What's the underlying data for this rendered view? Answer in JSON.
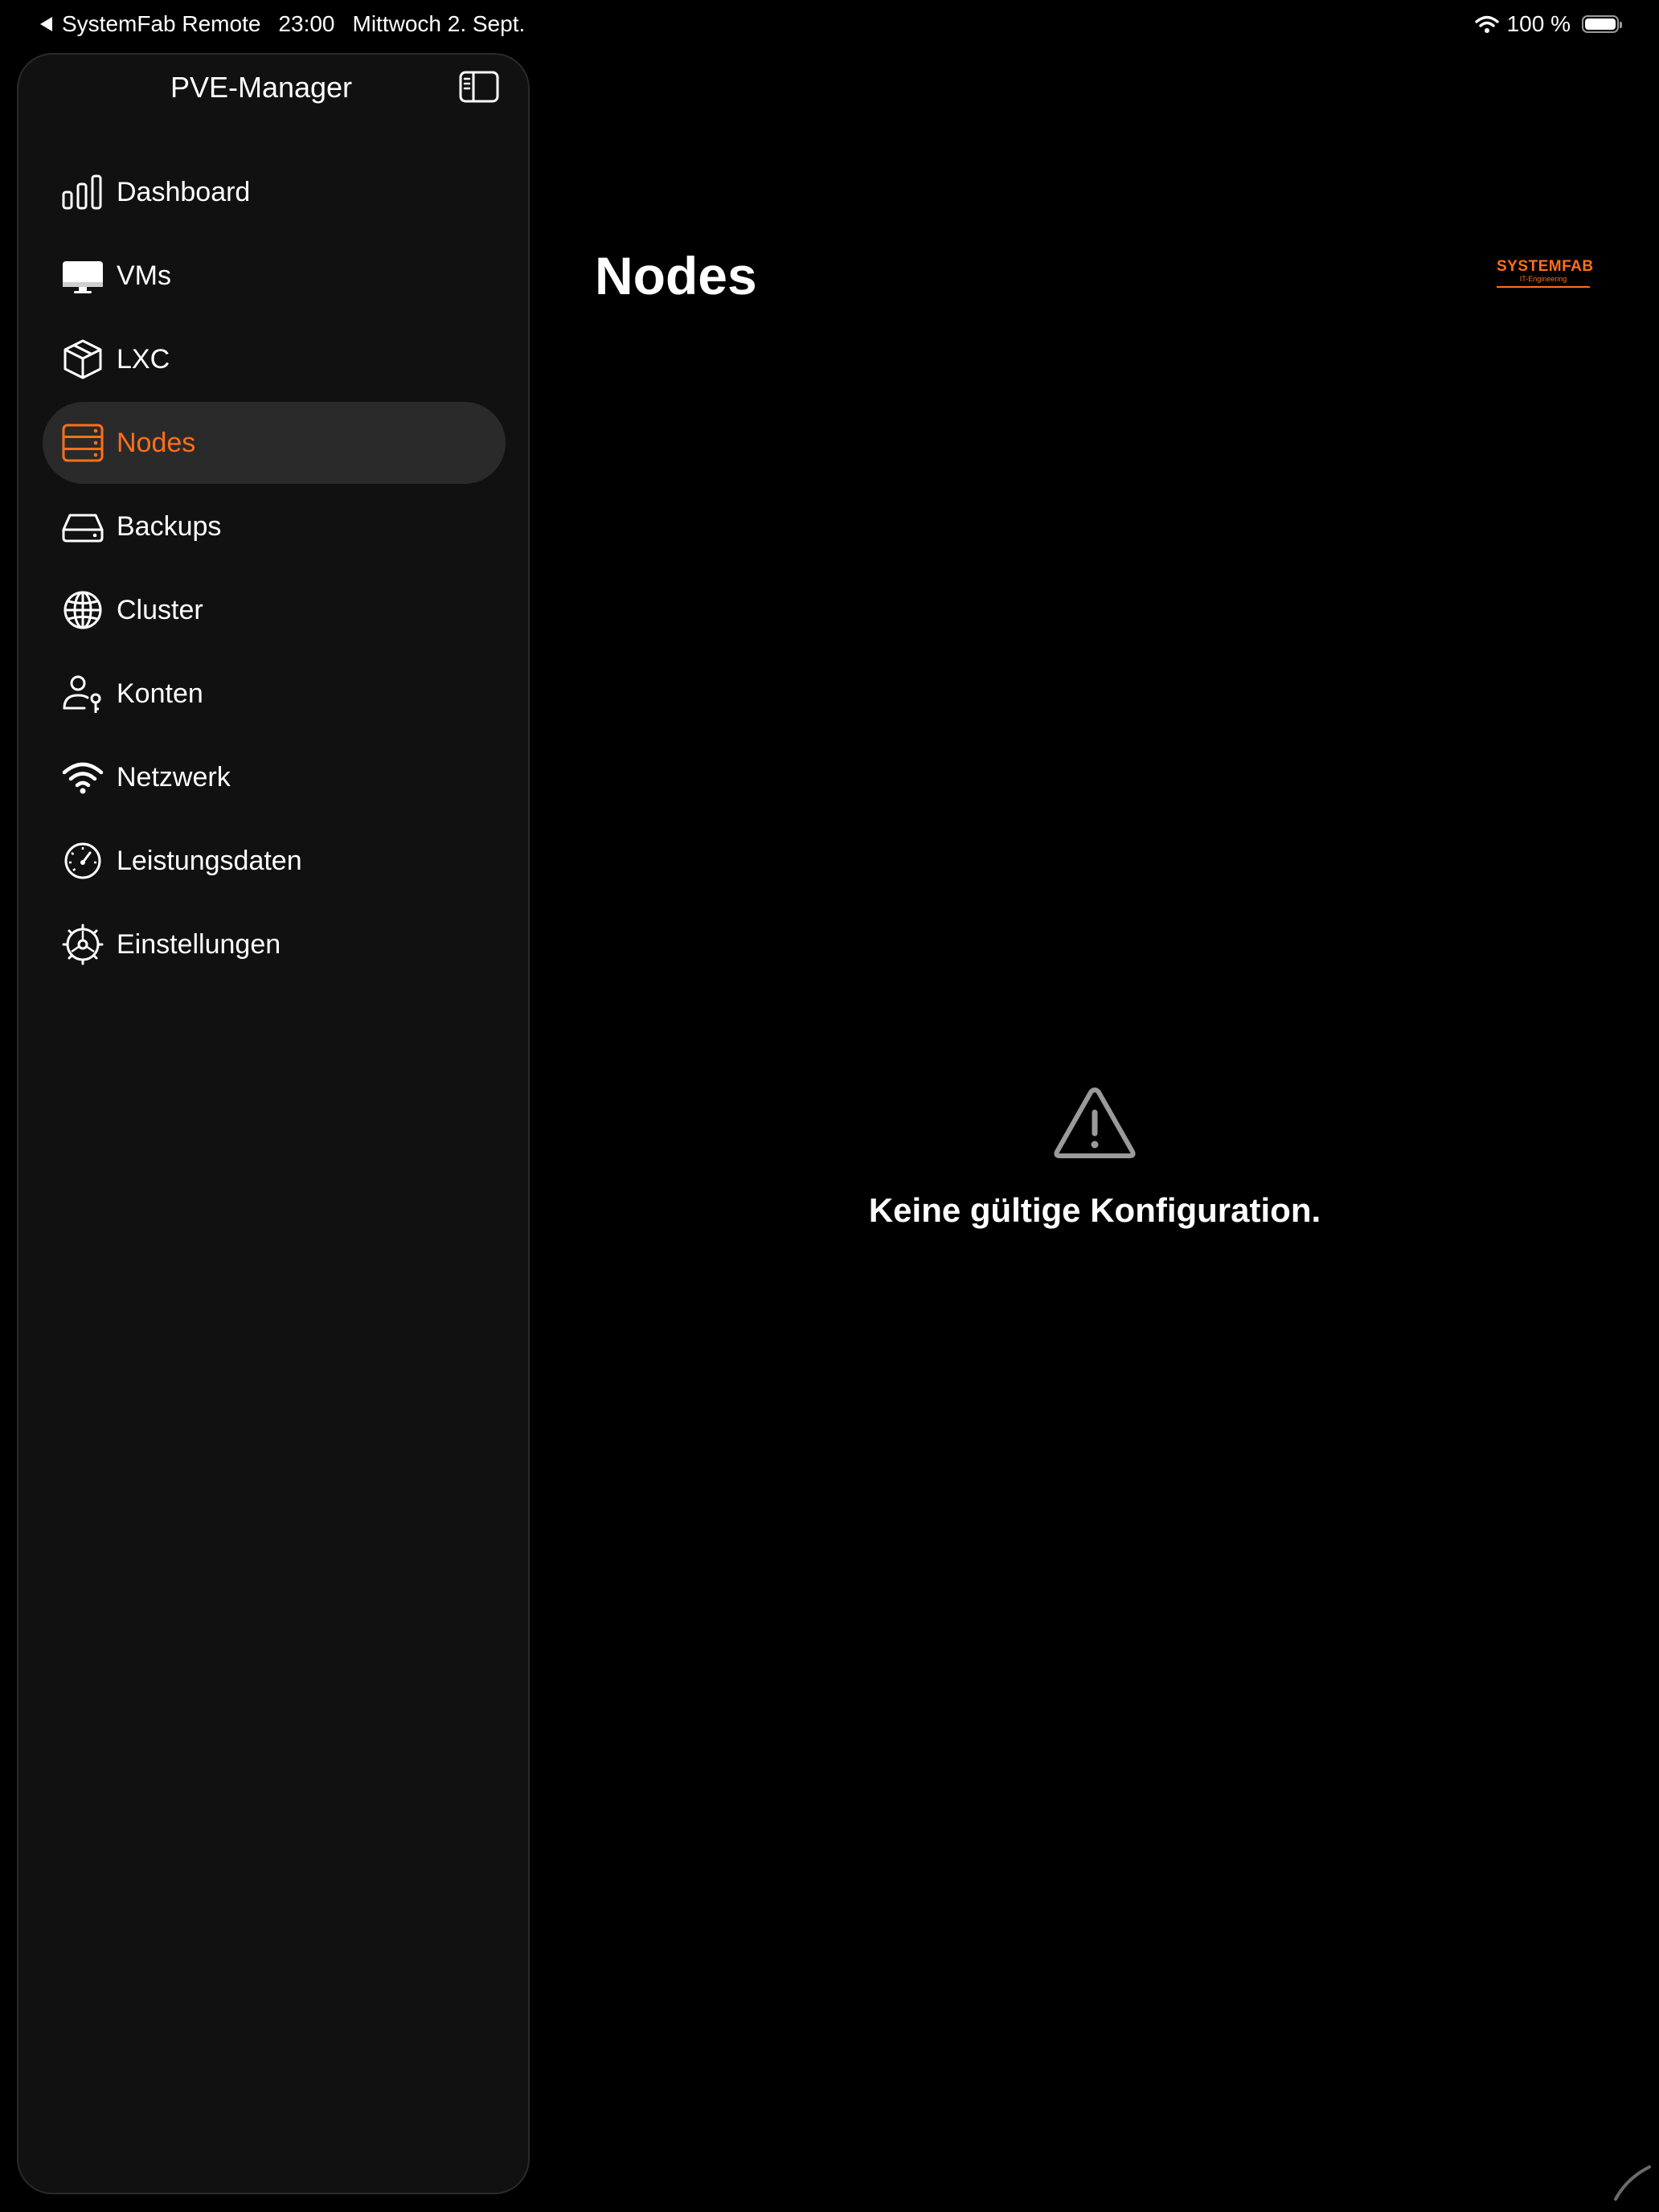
{
  "status_bar": {
    "back_app": "SystemFab Remote",
    "time": "23:00",
    "date": "Mittwoch 2. Sept.",
    "battery_text": "100 %",
    "battery_level": 1.0
  },
  "sidebar": {
    "title": "PVE-Manager",
    "items": [
      {
        "label": "Dashboard",
        "icon": "chart-bars-icon"
      },
      {
        "label": "VMs",
        "icon": "display-icon"
      },
      {
        "label": "LXC",
        "icon": "cube-icon"
      },
      {
        "label": "Nodes",
        "icon": "server-rack-icon",
        "selected": true
      },
      {
        "label": "Backups",
        "icon": "drive-icon"
      },
      {
        "label": "Cluster",
        "icon": "globe-icon"
      },
      {
        "label": "Konten",
        "icon": "person-key-icon"
      },
      {
        "label": "Netzwerk",
        "icon": "wifi-icon"
      },
      {
        "label": "Leistungsdaten",
        "icon": "gauge-icon"
      },
      {
        "label": "Einstellungen",
        "icon": "gear-icon"
      }
    ]
  },
  "main": {
    "title": "Nodes",
    "logo": {
      "line1": "SYSTEMFAB",
      "line2": "IT-Engineering"
    },
    "message": "Keine gültige Konfiguration."
  },
  "colors": {
    "accent": "#ff6f1a",
    "background": "#000000",
    "sidebar_bg": "#111111",
    "selected_bg": "#2a2a2a",
    "text": "#ffffff",
    "warning_icon": "#9a9a9a"
  }
}
